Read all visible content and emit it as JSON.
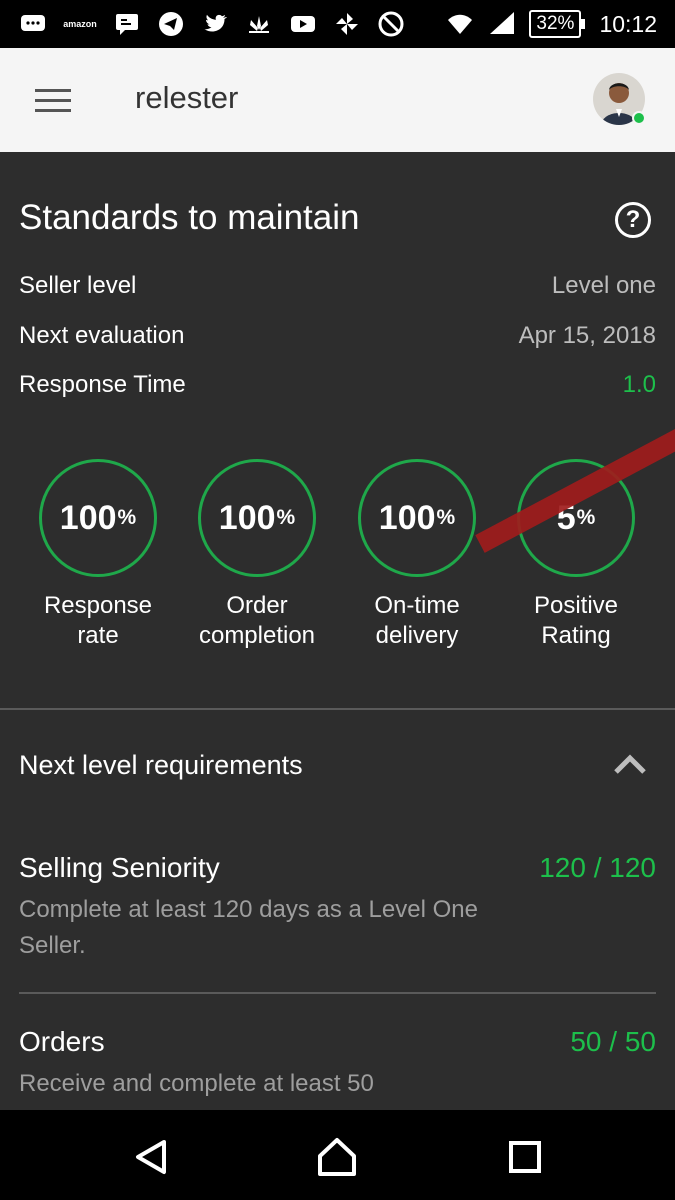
{
  "status_bar": {
    "icons": [
      "chat-bubble-icon",
      "amazon-icon",
      "message-icon",
      "telegram-icon",
      "twitter-icon",
      "lotus-icon",
      "youtube-icon",
      "pinwheel-icon",
      "blocked-icon"
    ],
    "amazon_text": "amazon",
    "battery": "32%",
    "time": "10:12"
  },
  "app_bar": {
    "title": "relester",
    "menu_icon": "hamburger-icon",
    "avatar_status": "online"
  },
  "standards": {
    "title": "Standards to maintain",
    "help_symbol": "?",
    "rows": [
      {
        "label": "Seller level",
        "value": "Level one"
      },
      {
        "label": "Next evaluation",
        "value": "Apr 15, 2018"
      },
      {
        "label": "Response Time",
        "value": "1.0"
      }
    ],
    "stats": [
      {
        "value": "100",
        "unit": "%",
        "label_line1": "Response",
        "label_line2": "rate"
      },
      {
        "value": "100",
        "unit": "%",
        "label_line1": "Order",
        "label_line2": "completion"
      },
      {
        "value": "100",
        "unit": "%",
        "label_line1": "On-time",
        "label_line2": "delivery"
      },
      {
        "value": "5",
        "unit": "%",
        "label_line1": "Positive",
        "label_line2": "Rating"
      }
    ]
  },
  "next_level": {
    "title": "Next level requirements",
    "requirements": [
      {
        "name": "Selling Seniority",
        "value": "120 / 120",
        "description": "Complete at least 120 days as a Level One Seller."
      },
      {
        "name": "Orders",
        "value": "50 / 50",
        "description": "Receive and complete at least 50"
      }
    ]
  },
  "colors": {
    "accent_green": "#1dbf4b",
    "ring_green": "#1fa84a",
    "background": "#2d2d2d",
    "app_bar": "#f5f5f5",
    "annotation_red": "#a01c1c"
  },
  "nav_bar": {
    "icons": [
      "back-icon",
      "home-icon",
      "recents-icon"
    ]
  }
}
